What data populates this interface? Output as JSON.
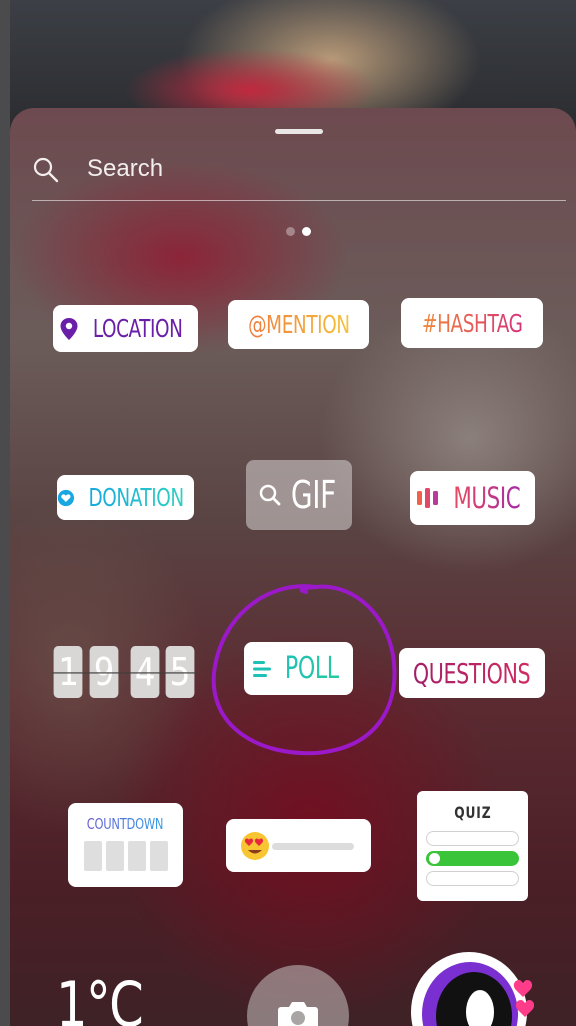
{
  "search": {
    "label": "Search"
  },
  "pager": {
    "pages": 2,
    "active_page": 2
  },
  "stickers": {
    "location": "LOCATION",
    "mention": "@MENTION",
    "hashtag": "#HASHTAG",
    "donation": "DONATION",
    "gif": "GIF",
    "music": "MUSIC",
    "poll": "POLL",
    "questions": "QUESTIONS",
    "countdown": "COUNTDOWN",
    "quiz": "QUIZ",
    "time_digits": [
      "1",
      "9",
      "4",
      "5"
    ],
    "temperature": "1°C"
  },
  "colors": {
    "location": "#6a1fa8",
    "donation": "#18a7e0",
    "music": "#e84a5f",
    "poll": "#1ec1b6",
    "questions": "#a31f6a",
    "annotation_circle": "#9b19c8"
  },
  "icons": [
    "search-icon",
    "location-pin-icon",
    "heart-icon",
    "gif-search-icon",
    "music-bars-icon",
    "poll-lines-icon",
    "heart-eyes-emoji-icon",
    "check-icon",
    "camera-icon"
  ]
}
